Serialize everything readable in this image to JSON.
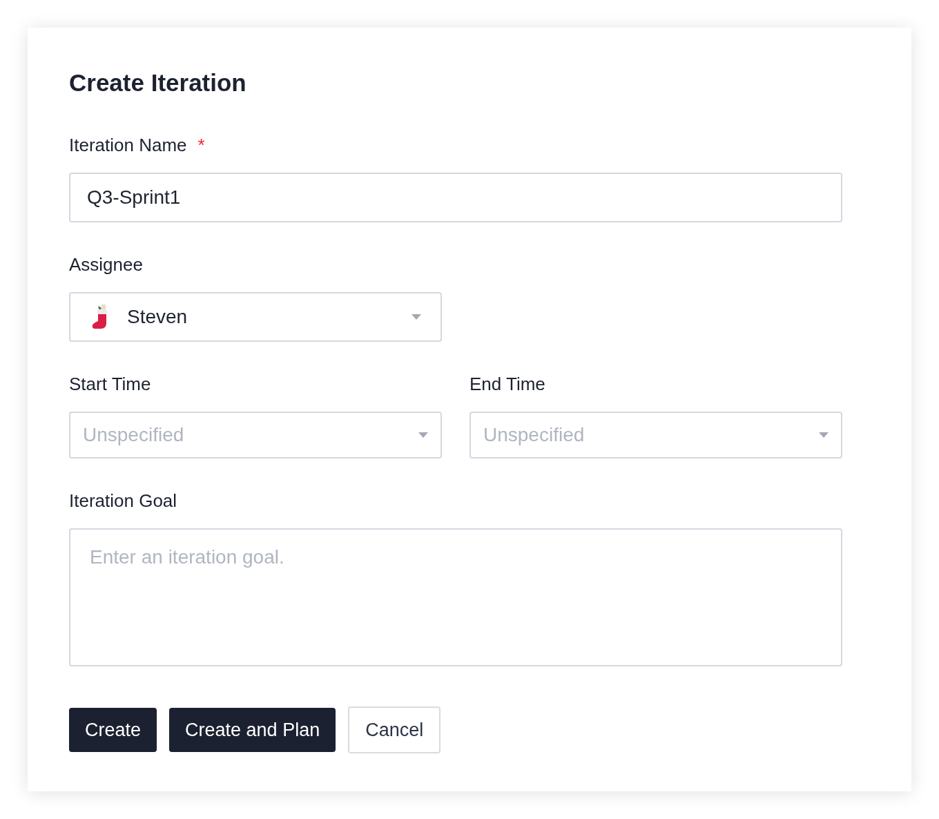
{
  "dialog": {
    "title": "Create Iteration",
    "rows": [
      {
        "fields": [
          {
            "kind": "text",
            "label": "Iteration Name",
            "required_mark": "*",
            "value": "Q3-Sprint1"
          }
        ]
      },
      {
        "fields": [
          {
            "kind": "user-select",
            "label": "Assignee",
            "value": "Steven"
          }
        ]
      },
      {
        "fields": [
          {
            "kind": "select",
            "label": "Start Time",
            "placeholder": "Unspecified"
          },
          {
            "kind": "select",
            "label": "End Time",
            "placeholder": "Unspecified"
          }
        ]
      },
      {
        "fields": [
          {
            "kind": "textarea",
            "label": "Iteration Goal",
            "placeholder": "Enter an iteration goal."
          }
        ]
      }
    ],
    "buttons": [
      {
        "label": "Create",
        "kind": "primary"
      },
      {
        "label": "Create and Plan",
        "kind": "primary"
      },
      {
        "label": "Cancel",
        "kind": "secondary"
      }
    ]
  }
}
